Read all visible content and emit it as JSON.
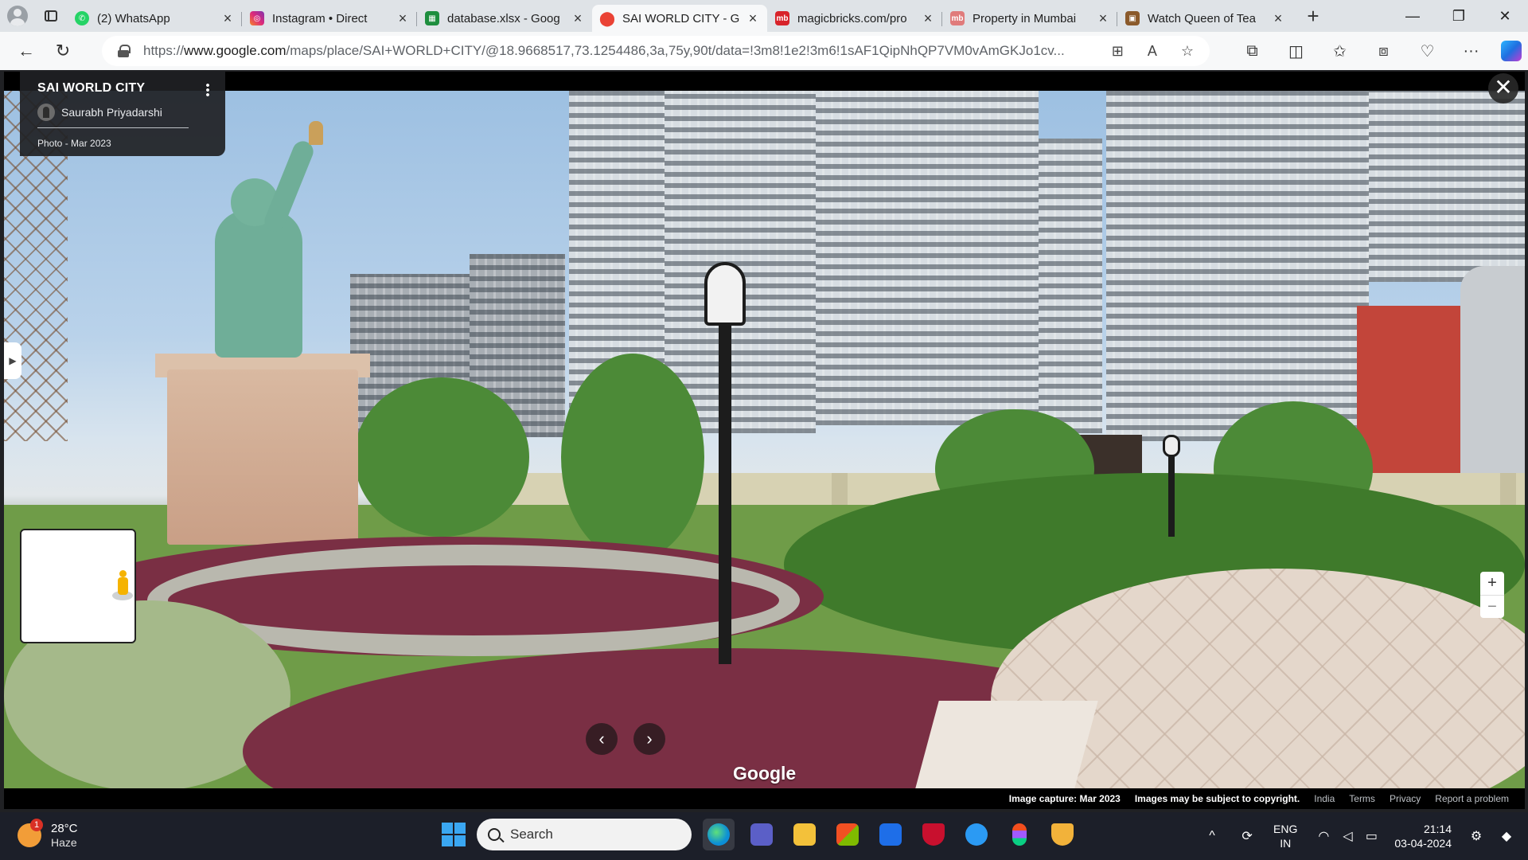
{
  "browser": {
    "tabs": [
      {
        "title": "(2) WhatsApp",
        "icon": "whatsapp-icon",
        "color": "#25d366",
        "active": false
      },
      {
        "title": "Instagram • Direct",
        "icon": "instagram-icon",
        "color": "#e1306c",
        "active": false
      },
      {
        "title": "database.xlsx - Goog",
        "icon": "sheets-icon",
        "color": "#1e8e3e",
        "active": false
      },
      {
        "title": "SAI WORLD CITY - G",
        "icon": "maps-pin-icon",
        "color": "#ea4335",
        "active": true
      },
      {
        "title": "magicbricks.com/pro",
        "icon": "magicbricks-icon",
        "color": "#d8232a",
        "active": false
      },
      {
        "title": "Property in Mumbai",
        "icon": "magicbricks-icon",
        "color": "#e07b7b",
        "active": false
      },
      {
        "title": "Watch Queen of Tea",
        "icon": "tv-icon",
        "color": "#8b5a2b",
        "active": false
      }
    ],
    "url_prefix": "https://",
    "url_host": "www.google.com",
    "url_path": "/maps/place/SAI+WORLD+CITY/@18.9668517,73.1254486,3a,75y,90t/data=!3m8!1e2!3m6!1sAF1QipNhQP7VM0vAmGKJo1cv..."
  },
  "viewer": {
    "place_title": "SAI WORLD CITY",
    "author": "Saurabh Priyadarshi",
    "photo_date": "Photo - Mar 2023",
    "google_logo": "Google",
    "footer": {
      "capture": "Image capture: Mar 2023",
      "copyright": "Images may be subject to copyright.",
      "region": "India",
      "terms": "Terms",
      "privacy": "Privacy",
      "report": "Report a problem"
    }
  },
  "taskbar": {
    "weather_temp": "28°C",
    "weather_cond": "Haze",
    "weather_badge": "1",
    "search_placeholder": "Search",
    "lang_top": "ENG",
    "lang_bottom": "IN",
    "time": "21:14",
    "date": "03-04-2024"
  }
}
